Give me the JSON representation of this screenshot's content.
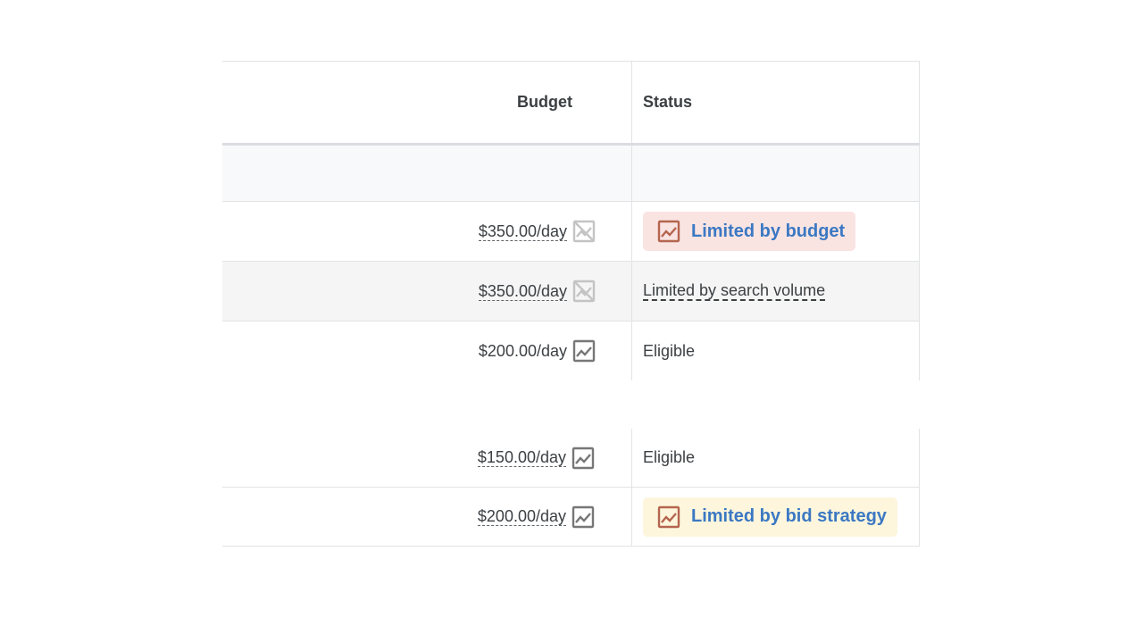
{
  "header": {
    "budget_label": "Budget",
    "status_label": "Status"
  },
  "table_top": [
    {
      "budget": "$350.00/day",
      "budget_dashed": true,
      "icon": "chart-disabled-icon",
      "status": "Limited by budget",
      "status_kind": "chip-budget"
    },
    {
      "budget": "$350.00/day",
      "budget_dashed": true,
      "icon": "chart-disabled-icon",
      "status": "Limited by search volume",
      "status_kind": "dashed-text"
    },
    {
      "budget": "$200.00/day",
      "budget_dashed": false,
      "icon": "chart-icon",
      "status": "Eligible",
      "status_kind": "text"
    }
  ],
  "table_bottom": [
    {
      "budget": "$150.00/day",
      "budget_dashed": true,
      "icon": "chart-icon",
      "status": "Eligible",
      "status_kind": "text"
    },
    {
      "budget": "$200.00/day",
      "budget_dashed": true,
      "icon": "chart-icon",
      "status": "Limited by bid strategy",
      "status_kind": "chip-bid"
    }
  ],
  "colors": {
    "chip_budget_bg": "#f9e4e2",
    "chip_bid_bg": "#fdf6dd",
    "chip_text": "#3b78c3",
    "chip_icon": "#b5654f"
  }
}
